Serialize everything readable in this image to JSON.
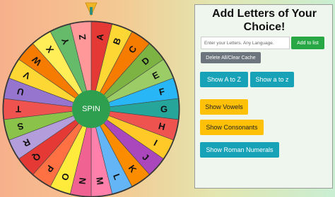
{
  "wheel": {
    "letters": [
      "A",
      "B",
      "C",
      "D",
      "E",
      "F",
      "G",
      "H",
      "I",
      "J",
      "K",
      "L",
      "M",
      "N",
      "O",
      "P",
      "Q",
      "R",
      "S",
      "T",
      "U",
      "V",
      "W",
      "X",
      "Y",
      "Z"
    ],
    "colors": [
      "#e53935",
      "#fdd835",
      "#f57c00",
      "#7cb342",
      "#9ccc65",
      "#29b6f6",
      "#26a69a",
      "#ef5350",
      "#ffca28",
      "#ab47bc",
      "#fb8c00",
      "#64b5f6",
      "#ff80ab",
      "#f06292",
      "#ffeb3b",
      "#ff7043",
      "#e53935",
      "#b39ddb",
      "#8bc34a",
      "#ef5350",
      "#9575cd",
      "#fdd835",
      "#f57c00",
      "#ffee58",
      "#66bb6a",
      "#ff9999"
    ],
    "spin_label": "SPIN",
    "hub_color": "#2e9e4f",
    "pointer_color": "#f0b429"
  },
  "panel": {
    "title_line1": "Add Letters of Your",
    "title_line2": "Choice!",
    "input_placeholder": "Enter your Letters. Any Language.",
    "add_button": "Add to list",
    "delete_button": "Delete All/Clear Cache",
    "show_a_to_z_upper": "Show A to Z",
    "show_a_to_z_lower": "Show a to z",
    "show_vowels": "Show Vowels",
    "show_consonants": "Show Consonants",
    "show_roman_numerals": "Show Roman Numerals"
  }
}
